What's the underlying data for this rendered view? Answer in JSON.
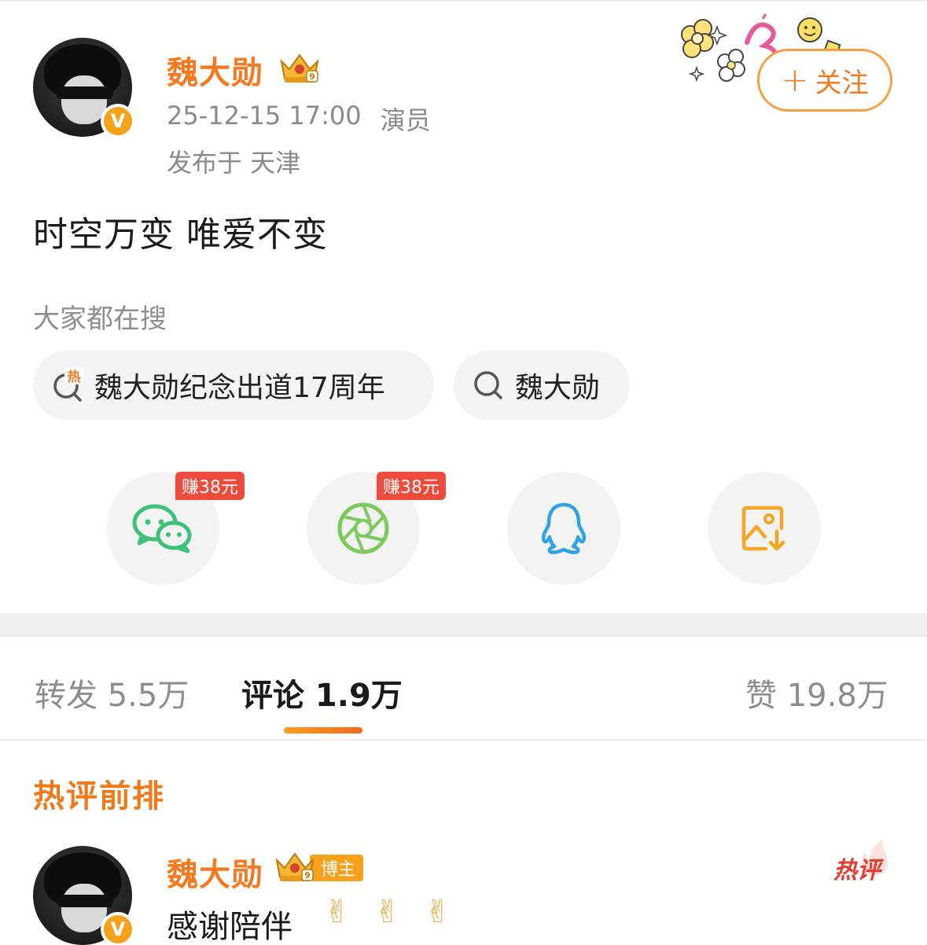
{
  "post": {
    "username": "魏大勋",
    "datetime": "25-12-15 17:00",
    "tag": "演员",
    "location": "发布于 天津",
    "follow_label": "关注",
    "follow_plus": "+",
    "text": "时空万变 唯爱不变",
    "verified_badge": "V"
  },
  "search": {
    "label": "大家都在搜",
    "chips": [
      {
        "text": "魏大勋纪念出道17周年",
        "icon": "hot-search-icon",
        "hot_glyph": "热"
      },
      {
        "text": "魏大勋",
        "icon": "search-icon"
      }
    ]
  },
  "share": {
    "earn_wechat": "赚38元",
    "earn_moments": "赚38元",
    "items": [
      {
        "icon": "wechat-icon",
        "color": "#3cc27a"
      },
      {
        "icon": "moments-icon",
        "color": "#7cc95c"
      },
      {
        "icon": "qq-icon",
        "color": "#2ea3e8"
      },
      {
        "icon": "save-image-icon",
        "color": "#f5a623"
      }
    ]
  },
  "tabs": {
    "repost": "转发 5.5万",
    "comment": "评论 1.9万",
    "like": "赞 19.8万"
  },
  "hot_comments": {
    "title": "热评前排",
    "comment": {
      "username": "魏大勋",
      "badge": "博主",
      "text": "感谢陪伴",
      "emoji": "✌",
      "hot_label": "热评"
    }
  },
  "colors": {
    "accent": "#f47920",
    "earn_red": "#ef4b3c",
    "hot_red": "#e53c32"
  }
}
